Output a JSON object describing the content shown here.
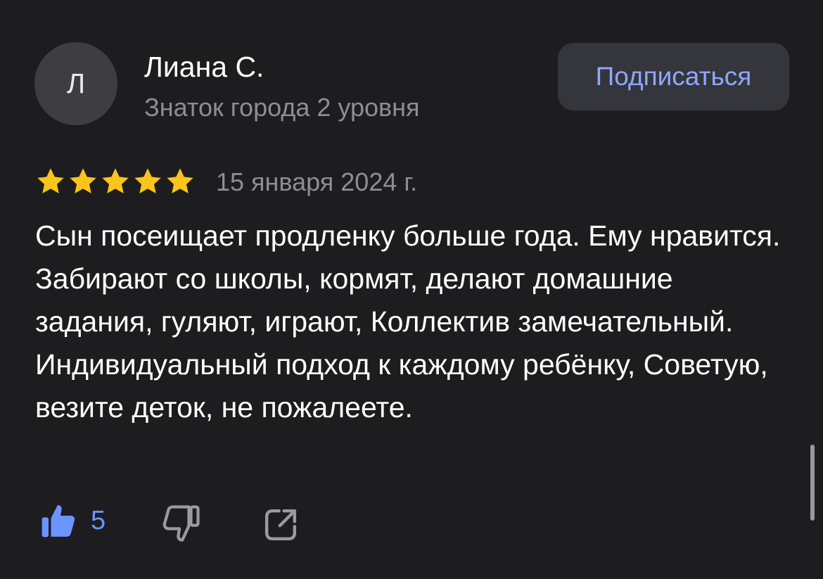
{
  "author": {
    "avatar_letter": "Л",
    "name": "Лиана С.",
    "level": "Знаток города 2 уровня"
  },
  "subscribe": {
    "label": "Подписаться"
  },
  "review": {
    "rating": 5,
    "rating_max": 5,
    "date": "15 января 2024 г.",
    "text": "Сын посеищает продленку больше года. Ему нравится. Забирают со школы, кормят, делают домашние задания, гуляют, играют, Коллектив замечательный. Индивидуальный подход к каждому ребёнку, Советую, везите деток, не пожалеете."
  },
  "actions": {
    "likes_count": "5",
    "like_icon": "thumbs-up-icon",
    "dislike_icon": "thumbs-down-icon",
    "share_icon": "share-icon"
  },
  "colors": {
    "background": "#1d1d20",
    "accent_blue": "#6d93ff",
    "star_yellow": "#f9c51a",
    "muted_text": "#8d8d93"
  }
}
